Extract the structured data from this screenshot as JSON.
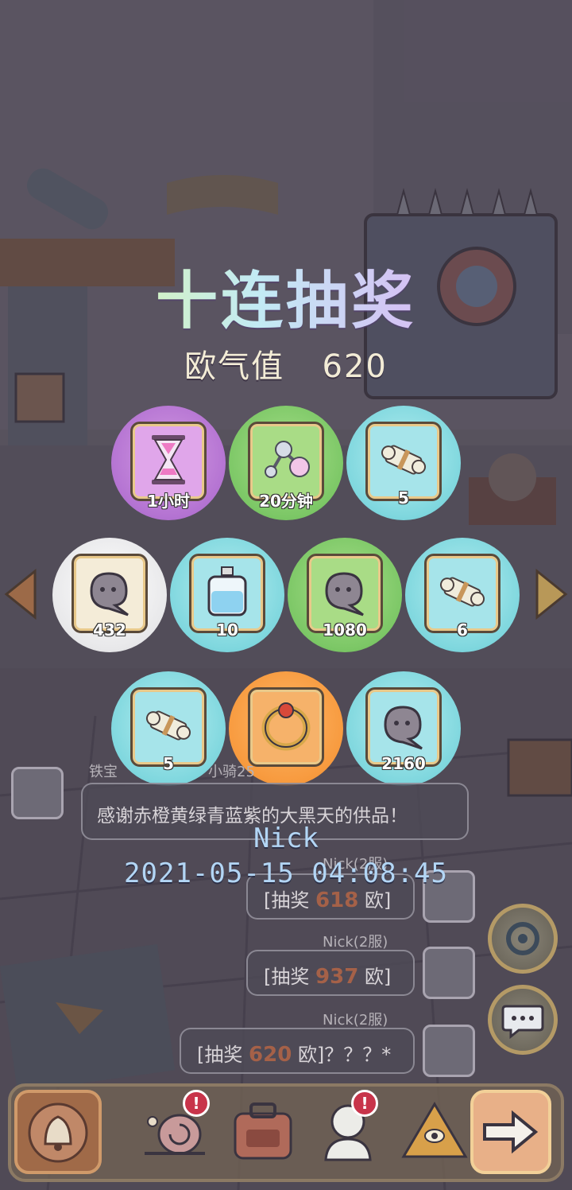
{
  "title": "十连抽奖",
  "luck_label": "欧气值",
  "luck_value": "620",
  "prizes": [
    {
      "icon": "hourglass-icon",
      "count": "1小时",
      "color": "purple"
    },
    {
      "icon": "molecule-icon",
      "count": "20分钟",
      "color": "green"
    },
    {
      "icon": "scroll-icon",
      "count": "5",
      "color": "teal"
    },
    {
      "icon": "ghost-blob-icon",
      "count": "432",
      "color": "white"
    },
    {
      "icon": "potion-bottle-icon",
      "count": "10",
      "color": "teal"
    },
    {
      "icon": "ghost-blob-icon",
      "count": "1080",
      "color": "green"
    },
    {
      "icon": "scroll-icon",
      "count": "6",
      "color": "teal"
    },
    {
      "icon": "scroll-icon",
      "count": "5",
      "color": "teal"
    },
    {
      "icon": "ring-icon",
      "count": "",
      "color": "orange"
    },
    {
      "icon": "ghost-blob-icon",
      "count": "2160",
      "color": "teal"
    }
  ],
  "chat": {
    "system_message": "感谢赤橙黄绿青蓝紫的大黑天的供品！",
    "partial_header": "铁宝",
    "partial_header_right": "小骑25",
    "messages": [
      {
        "name": "Nick",
        "server": "(2服)",
        "prefix": "[抽奖",
        "amount": "618",
        "suffix": "欧]"
      },
      {
        "name": "Nick",
        "server": "(2服)",
        "prefix": "[抽奖",
        "amount": "937",
        "suffix": "欧]"
      },
      {
        "name": "Nick",
        "server": "(2服)",
        "prefix": "[抽奖",
        "amount": "620",
        "suffix": "欧]？？？*"
      }
    ]
  },
  "watermark": {
    "nick": "Nick",
    "datetime": "2021-05-15 04:08:45"
  },
  "badges": [
    "!",
    "!"
  ],
  "colors": {
    "purple": "#b473d2",
    "green": "#7cc766",
    "teal": "#7fd7de",
    "white": "#e8e8ea",
    "orange": "#f79a3e",
    "overlay_text": "#b3d6f5",
    "chat_amount": "#a56148"
  }
}
